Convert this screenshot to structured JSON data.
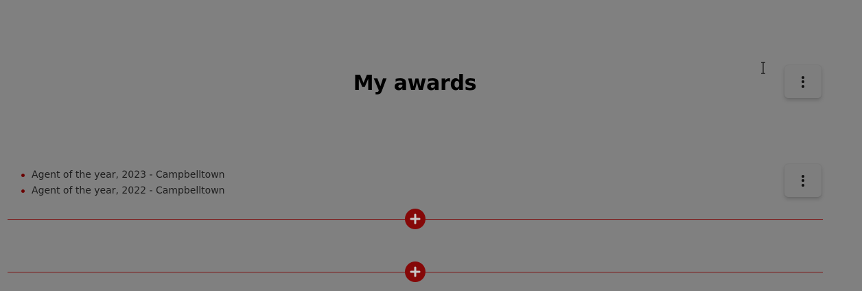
{
  "section": {
    "title": "My awards"
  },
  "awards": {
    "items": [
      "Agent of the year, 2023 - Campbelltown",
      "Agent of the year, 2022 - Campbelltown"
    ]
  },
  "icons": {
    "more": "more-vertical-icon",
    "add": "plus-icon",
    "cursor": "text-cursor-icon"
  },
  "colors": {
    "overlay_background": "#808080",
    "accent": "#850808",
    "divider": "#7c1212"
  }
}
